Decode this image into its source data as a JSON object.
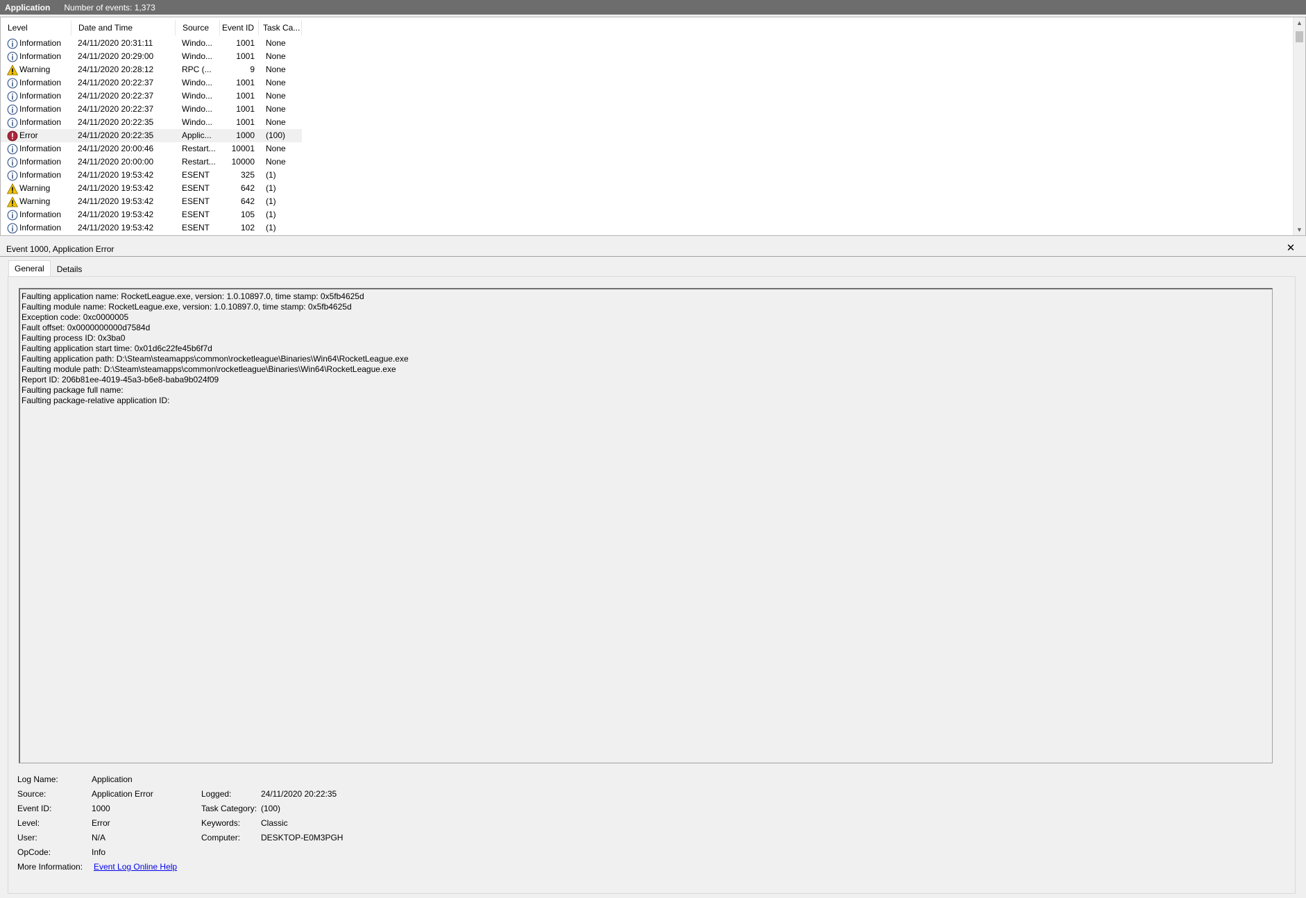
{
  "titlebar": {
    "app": "Application",
    "count": "Number of events: 1,373"
  },
  "columns": {
    "level": "Level",
    "date": "Date and Time",
    "source": "Source",
    "event_id": "Event ID",
    "task": "Task Ca..."
  },
  "rows": [
    {
      "level": "Information",
      "date": "24/11/2020 20:31:11",
      "source": "Windo...",
      "id": "1001",
      "task": "None",
      "kind": "info"
    },
    {
      "level": "Information",
      "date": "24/11/2020 20:29:00",
      "source": "Windo...",
      "id": "1001",
      "task": "None",
      "kind": "info"
    },
    {
      "level": "Warning",
      "date": "24/11/2020 20:28:12",
      "source": "RPC (...",
      "id": "9",
      "task": "None",
      "kind": "warning"
    },
    {
      "level": "Information",
      "date": "24/11/2020 20:22:37",
      "source": "Windo...",
      "id": "1001",
      "task": "None",
      "kind": "info"
    },
    {
      "level": "Information",
      "date": "24/11/2020 20:22:37",
      "source": "Windo...",
      "id": "1001",
      "task": "None",
      "kind": "info"
    },
    {
      "level": "Information",
      "date": "24/11/2020 20:22:37",
      "source": "Windo...",
      "id": "1001",
      "task": "None",
      "kind": "info"
    },
    {
      "level": "Information",
      "date": "24/11/2020 20:22:35",
      "source": "Windo...",
      "id": "1001",
      "task": "None",
      "kind": "info"
    },
    {
      "level": "Error",
      "date": "24/11/2020 20:22:35",
      "source": "Applic...",
      "id": "1000",
      "task": "(100)",
      "kind": "error",
      "selected": true
    },
    {
      "level": "Information",
      "date": "24/11/2020 20:00:46",
      "source": "Restart...",
      "id": "10001",
      "task": "None",
      "kind": "info"
    },
    {
      "level": "Information",
      "date": "24/11/2020 20:00:00",
      "source": "Restart...",
      "id": "10000",
      "task": "None",
      "kind": "info"
    },
    {
      "level": "Information",
      "date": "24/11/2020 19:53:42",
      "source": "ESENT",
      "id": "325",
      "task": "(1)",
      "kind": "info"
    },
    {
      "level": "Warning",
      "date": "24/11/2020 19:53:42",
      "source": "ESENT",
      "id": "642",
      "task": "(1)",
      "kind": "warning"
    },
    {
      "level": "Warning",
      "date": "24/11/2020 19:53:42",
      "source": "ESENT",
      "id": "642",
      "task": "(1)",
      "kind": "warning"
    },
    {
      "level": "Information",
      "date": "24/11/2020 19:53:42",
      "source": "ESENT",
      "id": "105",
      "task": "(1)",
      "kind": "info"
    },
    {
      "level": "Information",
      "date": "24/11/2020 19:53:42",
      "source": "ESENT",
      "id": "102",
      "task": "(1)",
      "kind": "info"
    }
  ],
  "detail": {
    "title": "Event 1000, Application Error",
    "tabs": [
      "General",
      "Details"
    ],
    "description": [
      "Faulting application name: RocketLeague.exe, version: 1.0.10897.0, time stamp: 0x5fb4625d",
      "Faulting module name: RocketLeague.exe, version: 1.0.10897.0, time stamp: 0x5fb4625d",
      "Exception code: 0xc0000005",
      "Fault offset: 0x0000000000d7584d",
      "Faulting process ID: 0x3ba0",
      "Faulting application start time: 0x01d6c22fe45b6f7d",
      "Faulting application path: D:\\Steam\\steamapps\\common\\rocketleague\\Binaries\\Win64\\RocketLeague.exe",
      "Faulting module path: D:\\Steam\\steamapps\\common\\rocketleague\\Binaries\\Win64\\RocketLeague.exe",
      "Report ID: 206b81ee-4019-45a3-b6e8-baba9b024f09",
      "Faulting package full name: ",
      "Faulting package-relative application ID: "
    ],
    "props": {
      "log_name_label": "Log Name:",
      "log_name": "Application",
      "source_label": "Source:",
      "source": "Application Error",
      "logged_label": "Logged:",
      "logged": "24/11/2020 20:22:35",
      "event_id_label": "Event ID:",
      "event_id": "1000",
      "task_label": "Task Category:",
      "task": "(100)",
      "level_label": "Level:",
      "level": "Error",
      "keywords_label": "Keywords:",
      "keywords": "Classic",
      "user_label": "User:",
      "user": "N/A",
      "computer_label": "Computer:",
      "computer": "DESKTOP-E0M3PGH",
      "opcode_label": "OpCode:",
      "opcode": "Info",
      "more_label": "More Information:",
      "more_link": "Event Log Online Help"
    }
  },
  "colors": {
    "titlebar": "#6d6d6d",
    "info_icon": "#3c5a8c",
    "warning_icon": "#f2c200",
    "error_icon": "#b0243a",
    "link": "#0000ee"
  }
}
